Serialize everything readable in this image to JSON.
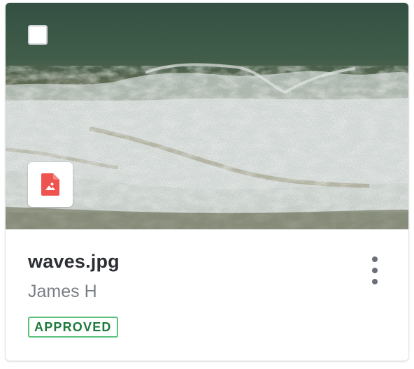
{
  "file": {
    "name": "waves.jpg",
    "owner": "James H",
    "status": "APPROVED",
    "type_icon": "image-file-icon",
    "selected": false
  },
  "colors": {
    "status_border": "#5cc27c",
    "status_text": "#1f7a3d",
    "file_icon": "#ef5350",
    "sea_deep": "#2f4f3e",
    "sand": "#9c8a63",
    "foam": "#eef1f0"
  },
  "icons": {
    "checkbox": "checkbox-icon",
    "more": "more-vertical-icon"
  }
}
